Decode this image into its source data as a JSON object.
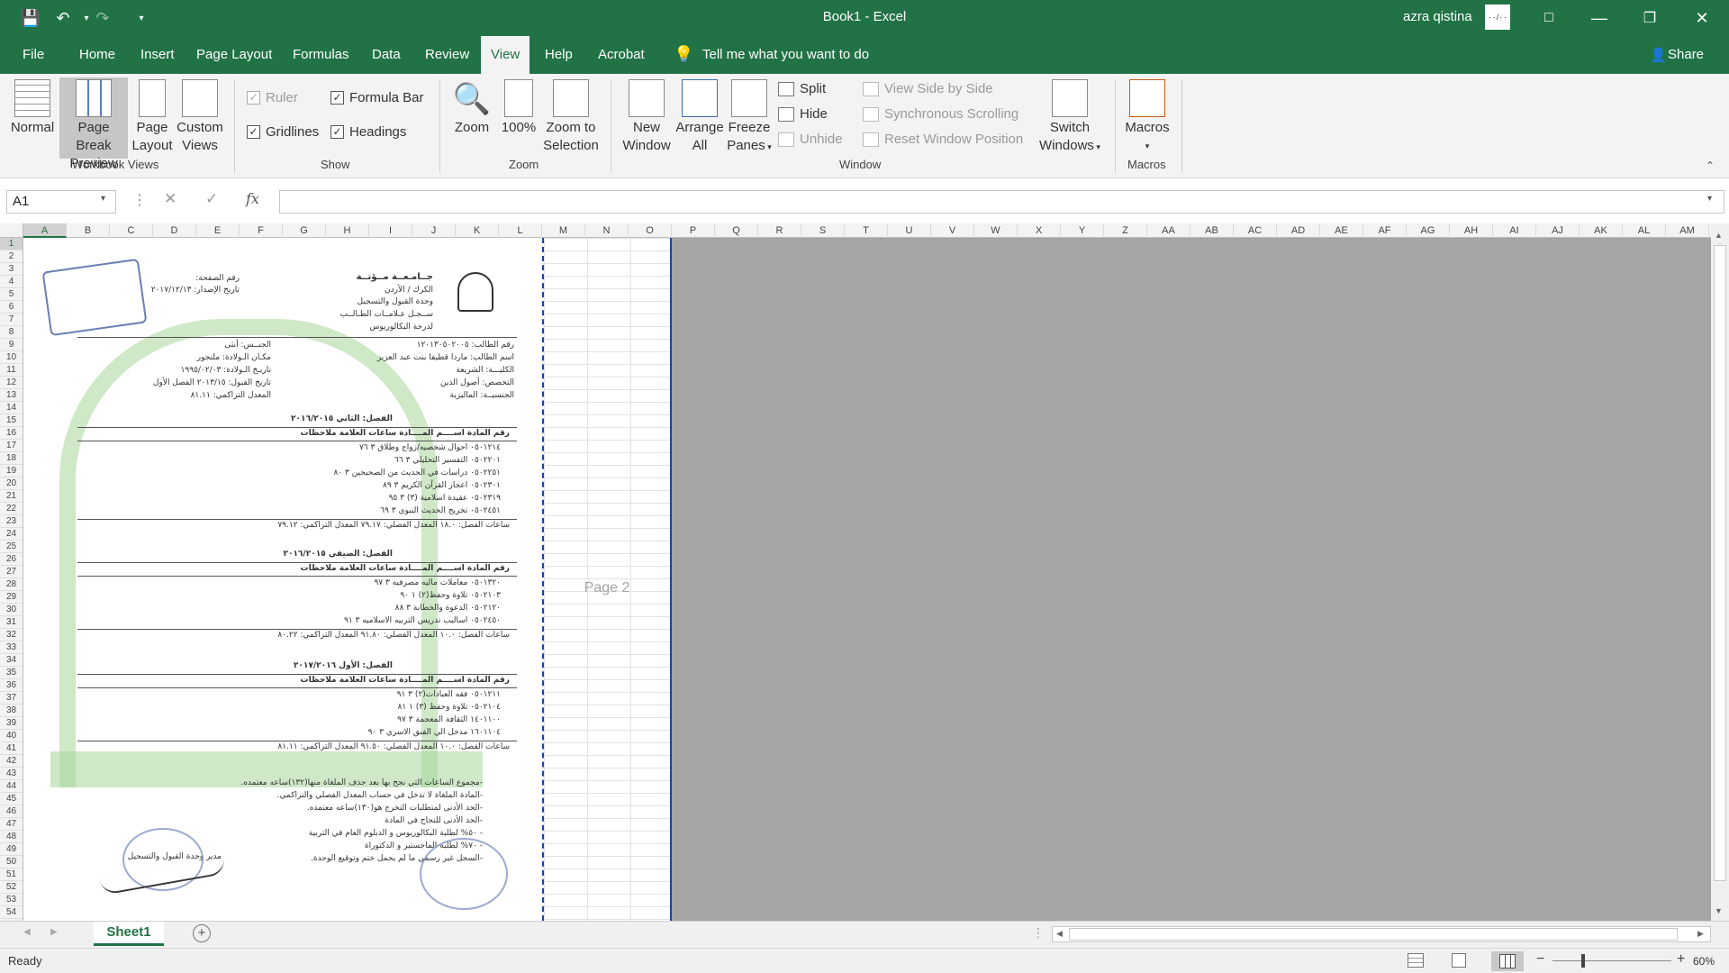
{
  "titlebar": {
    "doc_title": "Book1  -  Excel",
    "user_name": "azra qistina",
    "avatar_text": "٠٠/٠٠"
  },
  "menu_tabs": [
    "File",
    "Home",
    "Insert",
    "Page Layout",
    "Formulas",
    "Data",
    "Review",
    "View",
    "Help",
    "Acrobat"
  ],
  "active_tab": "View",
  "tell_me": "Tell me what you want to do",
  "share": "Share",
  "ribbon": {
    "workbook_views": {
      "label": "Workbook Views",
      "buttons": [
        {
          "line1": "Normal",
          "line2": ""
        },
        {
          "line1": "Page Break",
          "line2": "Preview"
        },
        {
          "line1": "Page",
          "line2": "Layout"
        },
        {
          "line1": "Custom",
          "line2": "Views"
        }
      ]
    },
    "show": {
      "label": "Show",
      "ruler": "Ruler",
      "formula_bar": "Formula Bar",
      "gridlines": "Gridlines",
      "headings": "Headings"
    },
    "zoom": {
      "label": "Zoom",
      "zoom": "Zoom",
      "hundred": "100%",
      "selection_1": "Zoom to",
      "selection_2": "Selection"
    },
    "window": {
      "label": "Window",
      "new_1": "New",
      "new_2": "Window",
      "arrange_1": "Arrange",
      "arrange_2": "All",
      "freeze_1": "Freeze",
      "freeze_2": "Panes",
      "split": "Split",
      "hide": "Hide",
      "unhide": "Unhide",
      "side_by_side": "View Side by Side",
      "sync_scroll": "Synchronous Scrolling",
      "reset_pos": "Reset Window Position",
      "switch_1": "Switch",
      "switch_2": "Windows"
    },
    "macros": {
      "label": "Macros",
      "button": "Macros"
    }
  },
  "formula_bar": {
    "name_box": "A1",
    "fx": "fx",
    "value": ""
  },
  "columns": [
    "A",
    "B",
    "C",
    "D",
    "E",
    "F",
    "G",
    "H",
    "I",
    "J",
    "K",
    "L",
    "M",
    "N",
    "O",
    "P",
    "Q",
    "R",
    "S",
    "T",
    "U",
    "V",
    "W",
    "X",
    "Y",
    "Z",
    "AA",
    "AB",
    "AC",
    "AD",
    "AE",
    "AF",
    "AG",
    "AH",
    "AI",
    "AJ",
    "AK",
    "AL",
    "AM"
  ],
  "rows": [
    "1",
    "2",
    "3",
    "4",
    "5",
    "6",
    "7",
    "8",
    "9",
    "10",
    "11",
    "12",
    "13",
    "14",
    "15",
    "16",
    "17",
    "18",
    "19",
    "20",
    "21",
    "22",
    "23",
    "24",
    "25",
    "26",
    "27",
    "28",
    "29",
    "30",
    "31",
    "32",
    "33",
    "34",
    "35",
    "36",
    "37",
    "38",
    "39",
    "40",
    "41",
    "42",
    "43",
    "44",
    "45",
    "46",
    "47",
    "48",
    "49",
    "50",
    "51",
    "52",
    "53",
    "54"
  ],
  "page2_label": "Page 2",
  "document": {
    "header_right": [
      "جــامـعــة مــؤتــة",
      "الكرك / الأردن",
      "وحدة القبول والتسجيل",
      "ســجـل عـلامــات الطـالــب",
      "لدرجة البكالوريوس"
    ],
    "header_left": [
      "رقم الصفحة:",
      "تاريخ الإصدار: ٢٠١٧/١٢/١٣"
    ],
    "student_info": [
      "رقم الطالب: ١٢٠١٣٠٥٠٢٠٠٥",
      "اسم الطالب: ماردا قطيفا بنت عبد العزيز",
      "الكليـــة: الشريعة",
      "التخصص: أصول الدين",
      "الجنسيــة: الماليزية"
    ],
    "student_info_left": [
      "الجنــس: أنثى",
      "مكـان الـولادة: ملنجور",
      "تاريـخ الـولادة: ١٩٩٥/٠٢/٠٣",
      "تاريخ القبول: ٢٠١٣/١٥ الفصل الأول",
      "المعدل التراكمي: ٨١.١١"
    ],
    "semesters": [
      {
        "title": "الفصل: الثاني  ٢٠١٦/٢٠١٥",
        "header": "رقم المادة   اســــم المــــادة   ساعات  العلامة   ملاحظات",
        "rows": [
          "٠٥٠١٢١٤  احوال شخصيه/زواج وطلاق  ٣  ٧٦",
          "٠٥٠٢٢٠١  التفسير التحليلي  ٣  ٦٦",
          "٠٥٠٢٢٥١  دراسات في الحديث من الصحيحين  ٣  ٨٠",
          "٠٥٠٢٣٠١  اعجاز القرآن الكريم  ٣  ٨٩",
          "٠٥٠٢٣١٩  عقيدة اسلامية (٣)  ٣  ٩٥",
          "٠٥٠٢٤٥١  تخريج الحديث النبوي  ٣  ٦٩"
        ],
        "summary": "ساعات الفصل: ١٨.٠   المعدل الفصلي: ٧٩.١٧   المعدل التراكمي: ٧٩.١٢"
      },
      {
        "title": "الفصل: الصيفي  ٢٠١٦/٢٠١٥",
        "header": "رقم المادة   اســــم المــــادة   ساعات  العلامة   ملاحظات",
        "rows": [
          "٠٥٠١٣٢٠  معاملات ماليه مصرفيه  ٣  ٩٧",
          "٠٥٠٢١٠٣  تلاوة وحفظ(٢)  ١  ٩٠",
          "٠٥٠٢١٢٠  الدعوة والخطابة  ٣  ٨٨",
          "٠٥٠٢٤٥٠  اساليب تدريس التربيه الاسلاميه  ٣  ٩١"
        ],
        "summary": "ساعات الفصل: ١٠.٠   المعدل الفصلي: ٩١.٨٠   المعدل التراكمي: ٨٠.٢٢"
      },
      {
        "title": "الفصل: الأول  ٢٠١٧/٢٠١٦",
        "header": "رقم المادة   اســــم المــــادة   ساعات  العلامة   ملاحظات",
        "rows": [
          "٠٥٠١٢١١  فقه العبادات(٢)  ٣  ٩١",
          "٠٥٠٢١٠٤  تلاوة وحفظ (٣)  ١  ٨١",
          "١٤٠١١٠٠  الثقافة المعجمة  ٣  ٩٧",
          "١٦٠١١٠٤  مدخل الي الفنق الاسري  ٣  ٩٠"
        ],
        "summary": "ساعات الفصل: ١٠.٠   المعدل الفصلي: ٩١.٥٠   المعدل التراكمي: ٨١.١١"
      }
    ],
    "notes": [
      "-مجموع الساعات التي نجح بها بعد حذف الملغاة منها(١٣٢)ساعه معتمده.",
      "-المادة الملغاة لا تدخل في حساب المعدل الفصلي والتراكمي.",
      "-الحد الأدنى لمتطلبات التخرج هو(١٣٠)ساعه معتمده.",
      "-الحد الأدنى للنجاح في المادة",
      "- ٥٠% لطلبة البكالوريوس و الدبلوم العام في التربية",
      "- ٧٠% لطلبة الماجستير و الدكتوراة",
      "-السجل غير رسمي ما لم يحمل ختم وتوقيع الوحدة."
    ],
    "signature_label": "مدير وحدة القبول والتسجيل"
  },
  "sheet_tab": "Sheet1",
  "status": {
    "ready": "Ready",
    "zoom": "60%"
  }
}
